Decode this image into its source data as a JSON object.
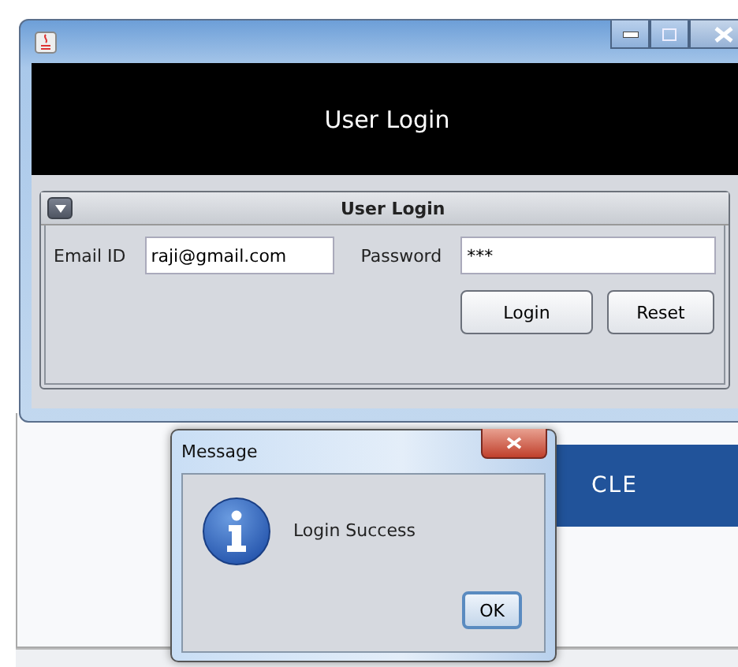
{
  "header": {
    "title": "User Login"
  },
  "panel": {
    "title": "User Login",
    "expanded": true
  },
  "fields": [
    {
      "label": "Email ID",
      "value": "raji@gmail.com"
    },
    {
      "label": "Password",
      "value": "***"
    }
  ],
  "buttons": [
    "Login",
    "Reset"
  ],
  "background": {
    "banner_text": "CLE"
  },
  "dialog": {
    "title": "Message",
    "message": "Login Success",
    "button": "OK"
  }
}
